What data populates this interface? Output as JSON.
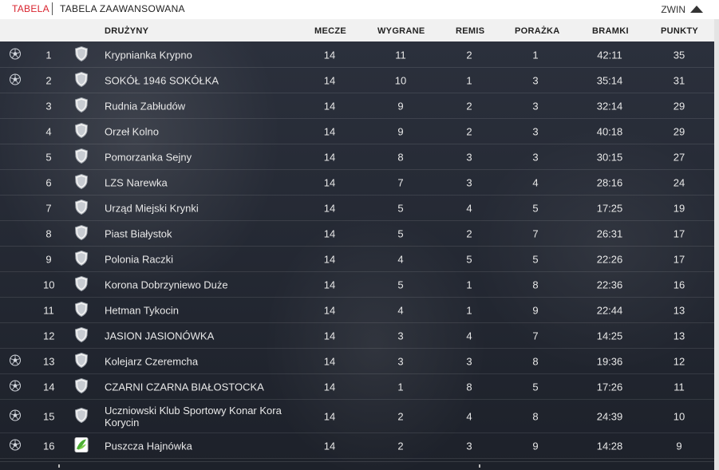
{
  "tabs": {
    "table": "TABELA",
    "advanced": "TABELA ZAAWANSOWANA"
  },
  "collapse_label": "ZWIN",
  "columns": {
    "team": "DRUŻYNY",
    "matches": "MECZE",
    "wins": "WYGRANE",
    "draws": "REMIS",
    "losses": "PORAŻKA",
    "goals": "BRAMKI",
    "points": "PUNKTY"
  },
  "rows": [
    {
      "pos": "1",
      "team": "Krypnianka Krypno",
      "m": "14",
      "w": "11",
      "d": "2",
      "l": "1",
      "g": "42:11",
      "p": "35",
      "ball": true,
      "crest": "shield-icon"
    },
    {
      "pos": "2",
      "team": "SOKÓŁ 1946 SOKÓŁKA",
      "m": "14",
      "w": "10",
      "d": "1",
      "l": "3",
      "g": "35:14",
      "p": "31",
      "ball": true,
      "crest": "shield-icon"
    },
    {
      "pos": "3",
      "team": "Rudnia Zabłudów",
      "m": "14",
      "w": "9",
      "d": "2",
      "l": "3",
      "g": "32:14",
      "p": "29",
      "ball": false,
      "crest": "shield-icon"
    },
    {
      "pos": "4",
      "team": "Orzeł Kolno",
      "m": "14",
      "w": "9",
      "d": "2",
      "l": "3",
      "g": "40:18",
      "p": "29",
      "ball": false,
      "crest": "shield-icon"
    },
    {
      "pos": "5",
      "team": "Pomorzanka Sejny",
      "m": "14",
      "w": "8",
      "d": "3",
      "l": "3",
      "g": "30:15",
      "p": "27",
      "ball": false,
      "crest": "shield-icon"
    },
    {
      "pos": "6",
      "team": "LZS Narewka",
      "m": "14",
      "w": "7",
      "d": "3",
      "l": "4",
      "g": "28:16",
      "p": "24",
      "ball": false,
      "crest": "shield-icon"
    },
    {
      "pos": "7",
      "team": "Urząd Miejski Krynki",
      "m": "14",
      "w": "5",
      "d": "4",
      "l": "5",
      "g": "17:25",
      "p": "19",
      "ball": false,
      "crest": "shield-icon"
    },
    {
      "pos": "8",
      "team": "Piast Białystok",
      "m": "14",
      "w": "5",
      "d": "2",
      "l": "7",
      "g": "26:31",
      "p": "17",
      "ball": false,
      "crest": "shield-icon"
    },
    {
      "pos": "9",
      "team": "Polonia Raczki",
      "m": "14",
      "w": "4",
      "d": "5",
      "l": "5",
      "g": "22:26",
      "p": "17",
      "ball": false,
      "crest": "shield-icon"
    },
    {
      "pos": "10",
      "team": "Korona Dobrzyniewo Duże",
      "m": "14",
      "w": "5",
      "d": "1",
      "l": "8",
      "g": "22:36",
      "p": "16",
      "ball": false,
      "crest": "shield-icon"
    },
    {
      "pos": "11",
      "team": "Hetman Tykocin",
      "m": "14",
      "w": "4",
      "d": "1",
      "l": "9",
      "g": "22:44",
      "p": "13",
      "ball": false,
      "crest": "shield-icon"
    },
    {
      "pos": "12",
      "team": "JASION JASIONÓWKA",
      "m": "14",
      "w": "3",
      "d": "4",
      "l": "7",
      "g": "14:25",
      "p": "13",
      "ball": false,
      "crest": "shield-icon"
    },
    {
      "pos": "13",
      "team": "Kolejarz Czeremcha",
      "m": "14",
      "w": "3",
      "d": "3",
      "l": "8",
      "g": "19:36",
      "p": "12",
      "ball": true,
      "crest": "shield-icon"
    },
    {
      "pos": "14",
      "team": "CZARNI CZARNA BIAŁOSTOCKA",
      "m": "14",
      "w": "1",
      "d": "8",
      "l": "5",
      "g": "17:26",
      "p": "11",
      "ball": true,
      "crest": "shield-icon"
    },
    {
      "pos": "15",
      "team": "Uczniowski Klub Sportowy Konar Kora Korycin",
      "m": "14",
      "w": "2",
      "d": "4",
      "l": "8",
      "g": "24:39",
      "p": "10",
      "ball": true,
      "crest": "shield-icon",
      "tall": true
    },
    {
      "pos": "16",
      "team": "Puszcza Hajnówka",
      "m": "14",
      "w": "2",
      "d": "3",
      "l": "9",
      "g": "14:28",
      "p": "9",
      "ball": true,
      "crest": "green-crest-icon"
    }
  ],
  "colors": {
    "accent": "#d9232e",
    "header_bg": "#f1f1f1",
    "row_text": "#e8e8e8"
  }
}
